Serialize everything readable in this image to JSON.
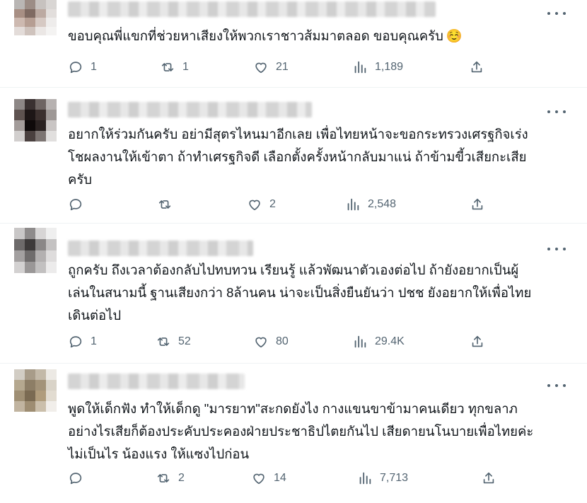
{
  "tweets": [
    {
      "text": "ขอบคุณพี่แขกที่ช่วยหาเสียงให้พวกเราชาวส้มมาตลอด ขอบคุณครับ",
      "emoji": "☺️",
      "replies": "1",
      "reposts": "1",
      "likes": "21",
      "views": "1,189"
    },
    {
      "text": "อยากให้ร่วมกันครับ อย่ามีสุตรไหนมาอีกเลย เพื่อไทยหน้าจะขอกระทรวงเศรฐกิจเร่ง\nโชผลงานให้เข้าตา ถ้าทำเศรฐกิจดี เลือกตั้งครั้งหน้ากลับมาแน่ ถ้าข้ามขี้วเสียกะเสีย\nครับ",
      "emoji": "",
      "replies": "",
      "reposts": "",
      "likes": "2",
      "views": "2,548"
    },
    {
      "text": "ถูกครับ ถึงเวลาต้องกลับไปทบทวน เรียนรู้ แล้วพัฒนาตัวเองต่อไป ถ้ายังอยากเป็นผู้\nเล่นในสนามนี้ ฐานเสียงกว่า 8ล้านคน น่าจะเป็นสิ่งยืนยันว่า ปชช ยังอยากให้เพื่อไทย\nเดินต่อไป",
      "emoji": "",
      "replies": "1",
      "reposts": "52",
      "likes": "80",
      "views": "29.4K"
    },
    {
      "text": "พูดให้เด็กฟัง ทำให้เด็กดู \"มารยาท\"สะกดยังไง กางแขนขาข้ามาคนเดียว ทุกขลาภ\nอย่างไรเสียก็ต้องประคับประคองฝ่ายประชาธิปไตยกันไป เสียดายนโนบายเพื่อไทยค่ะ\nไม่เป็นไร น้องแรง ให้แซงไปก่อน",
      "emoji": "",
      "replies": "",
      "reposts": "2",
      "likes": "14",
      "views": "7,713"
    }
  ],
  "icons": {
    "reply": "reply-icon",
    "repost": "repost-icon",
    "like": "like-icon",
    "views": "views-icon",
    "share": "share-icon",
    "more": "more-icon"
  },
  "colors": {
    "text": "#0f1419",
    "muted": "#536471",
    "divider": "#eff3f4"
  }
}
